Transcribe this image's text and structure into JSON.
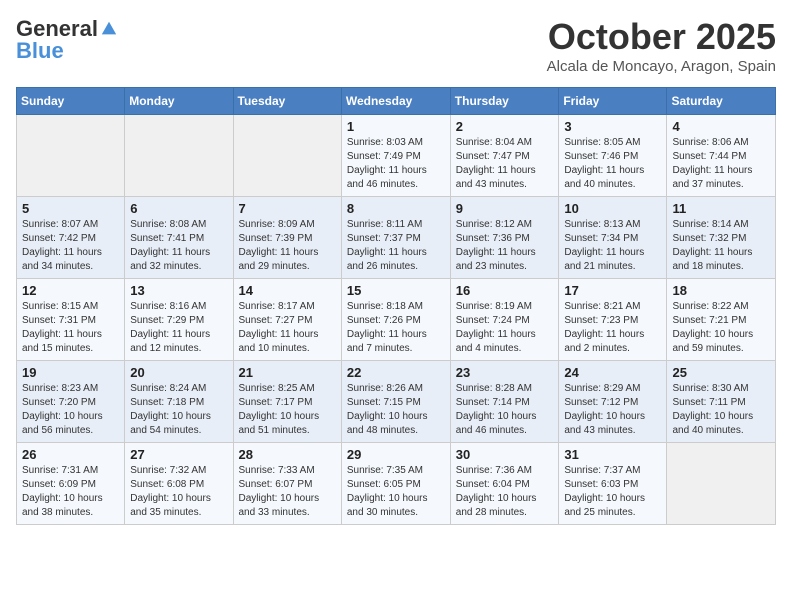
{
  "header": {
    "logo_general": "General",
    "logo_blue": "Blue",
    "month": "October 2025",
    "location": "Alcala de Moncayo, Aragon, Spain"
  },
  "weekdays": [
    "Sunday",
    "Monday",
    "Tuesday",
    "Wednesday",
    "Thursday",
    "Friday",
    "Saturday"
  ],
  "weeks": [
    [
      {
        "day": "",
        "info": ""
      },
      {
        "day": "",
        "info": ""
      },
      {
        "day": "",
        "info": ""
      },
      {
        "day": "1",
        "info": "Sunrise: 8:03 AM\nSunset: 7:49 PM\nDaylight: 11 hours and 46 minutes."
      },
      {
        "day": "2",
        "info": "Sunrise: 8:04 AM\nSunset: 7:47 PM\nDaylight: 11 hours and 43 minutes."
      },
      {
        "day": "3",
        "info": "Sunrise: 8:05 AM\nSunset: 7:46 PM\nDaylight: 11 hours and 40 minutes."
      },
      {
        "day": "4",
        "info": "Sunrise: 8:06 AM\nSunset: 7:44 PM\nDaylight: 11 hours and 37 minutes."
      }
    ],
    [
      {
        "day": "5",
        "info": "Sunrise: 8:07 AM\nSunset: 7:42 PM\nDaylight: 11 hours and 34 minutes."
      },
      {
        "day": "6",
        "info": "Sunrise: 8:08 AM\nSunset: 7:41 PM\nDaylight: 11 hours and 32 minutes."
      },
      {
        "day": "7",
        "info": "Sunrise: 8:09 AM\nSunset: 7:39 PM\nDaylight: 11 hours and 29 minutes."
      },
      {
        "day": "8",
        "info": "Sunrise: 8:11 AM\nSunset: 7:37 PM\nDaylight: 11 hours and 26 minutes."
      },
      {
        "day": "9",
        "info": "Sunrise: 8:12 AM\nSunset: 7:36 PM\nDaylight: 11 hours and 23 minutes."
      },
      {
        "day": "10",
        "info": "Sunrise: 8:13 AM\nSunset: 7:34 PM\nDaylight: 11 hours and 21 minutes."
      },
      {
        "day": "11",
        "info": "Sunrise: 8:14 AM\nSunset: 7:32 PM\nDaylight: 11 hours and 18 minutes."
      }
    ],
    [
      {
        "day": "12",
        "info": "Sunrise: 8:15 AM\nSunset: 7:31 PM\nDaylight: 11 hours and 15 minutes."
      },
      {
        "day": "13",
        "info": "Sunrise: 8:16 AM\nSunset: 7:29 PM\nDaylight: 11 hours and 12 minutes."
      },
      {
        "day": "14",
        "info": "Sunrise: 8:17 AM\nSunset: 7:27 PM\nDaylight: 11 hours and 10 minutes."
      },
      {
        "day": "15",
        "info": "Sunrise: 8:18 AM\nSunset: 7:26 PM\nDaylight: 11 hours and 7 minutes."
      },
      {
        "day": "16",
        "info": "Sunrise: 8:19 AM\nSunset: 7:24 PM\nDaylight: 11 hours and 4 minutes."
      },
      {
        "day": "17",
        "info": "Sunrise: 8:21 AM\nSunset: 7:23 PM\nDaylight: 11 hours and 2 minutes."
      },
      {
        "day": "18",
        "info": "Sunrise: 8:22 AM\nSunset: 7:21 PM\nDaylight: 10 hours and 59 minutes."
      }
    ],
    [
      {
        "day": "19",
        "info": "Sunrise: 8:23 AM\nSunset: 7:20 PM\nDaylight: 10 hours and 56 minutes."
      },
      {
        "day": "20",
        "info": "Sunrise: 8:24 AM\nSunset: 7:18 PM\nDaylight: 10 hours and 54 minutes."
      },
      {
        "day": "21",
        "info": "Sunrise: 8:25 AM\nSunset: 7:17 PM\nDaylight: 10 hours and 51 minutes."
      },
      {
        "day": "22",
        "info": "Sunrise: 8:26 AM\nSunset: 7:15 PM\nDaylight: 10 hours and 48 minutes."
      },
      {
        "day": "23",
        "info": "Sunrise: 8:28 AM\nSunset: 7:14 PM\nDaylight: 10 hours and 46 minutes."
      },
      {
        "day": "24",
        "info": "Sunrise: 8:29 AM\nSunset: 7:12 PM\nDaylight: 10 hours and 43 minutes."
      },
      {
        "day": "25",
        "info": "Sunrise: 8:30 AM\nSunset: 7:11 PM\nDaylight: 10 hours and 40 minutes."
      }
    ],
    [
      {
        "day": "26",
        "info": "Sunrise: 7:31 AM\nSunset: 6:09 PM\nDaylight: 10 hours and 38 minutes."
      },
      {
        "day": "27",
        "info": "Sunrise: 7:32 AM\nSunset: 6:08 PM\nDaylight: 10 hours and 35 minutes."
      },
      {
        "day": "28",
        "info": "Sunrise: 7:33 AM\nSunset: 6:07 PM\nDaylight: 10 hours and 33 minutes."
      },
      {
        "day": "29",
        "info": "Sunrise: 7:35 AM\nSunset: 6:05 PM\nDaylight: 10 hours and 30 minutes."
      },
      {
        "day": "30",
        "info": "Sunrise: 7:36 AM\nSunset: 6:04 PM\nDaylight: 10 hours and 28 minutes."
      },
      {
        "day": "31",
        "info": "Sunrise: 7:37 AM\nSunset: 6:03 PM\nDaylight: 10 hours and 25 minutes."
      },
      {
        "day": "",
        "info": ""
      }
    ]
  ]
}
